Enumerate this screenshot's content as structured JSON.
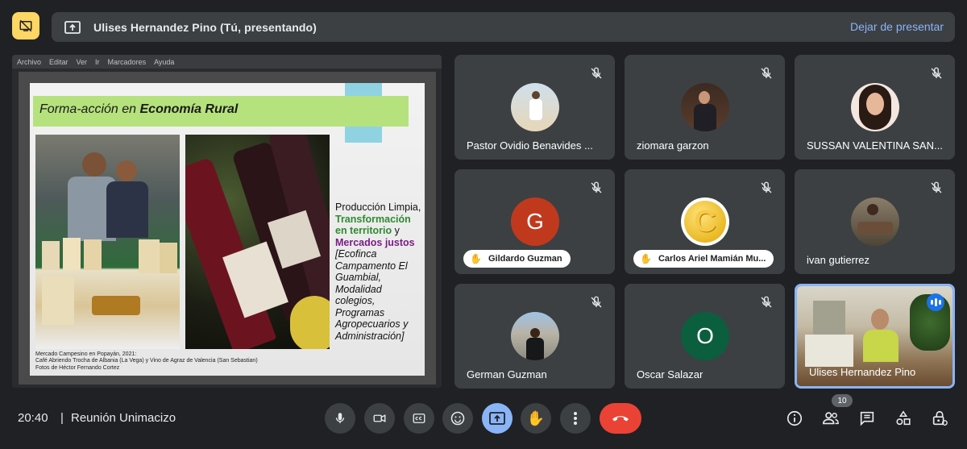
{
  "colors": {
    "accent": "#8ab4f8",
    "end_call": "#ea4335",
    "present_badge": "#fdd663",
    "background": "#202124",
    "tile": "#3c4043"
  },
  "top": {
    "presenting_icon": "no-present-icon",
    "banner_title": "Ulises Hernandez Pino (Tú, presentando)",
    "stop_label": "Dejar de presentar"
  },
  "shared_screen": {
    "menu": [
      "Archivo",
      "Editar",
      "Ver",
      "Ir",
      "Marcadores",
      "Ayuda"
    ],
    "slide": {
      "title_prefix": "Forma-acción en ",
      "title_bold": "Economía Rural",
      "text_1": "Producción Limpia, ",
      "text_green": "Transformación en territorio",
      "text_2": " y ",
      "text_purple": "Mercados justos",
      "text_italic": " [Ecofinca Campamento El Guambial, Modalidad colegios, Programas Agropecuarios y Administración]",
      "caption_1": "Mercado Campesino en Popayán, 2021:",
      "caption_2": "Café Abriendo Trocha de Albania (La Vega) y Vino de Agraz de Valencia (San Sebastian)",
      "caption_3": "Fotos de Héctor Fernando Cortez"
    }
  },
  "participants": [
    {
      "name": "Pastor Ovidio Benavides ...",
      "avatar": "photo",
      "muted": true
    },
    {
      "name": "ziomara garzon",
      "avatar": "photo",
      "muted": true
    },
    {
      "name": "SUSSAN VALENTINA SAN...",
      "avatar": "photo",
      "muted": true
    },
    {
      "name": "Gildardo Guzman",
      "avatar_letter": "G",
      "avatar_color": "#c1391d",
      "hand_raised": true,
      "muted": true
    },
    {
      "name": "Carlos Ariel Mamián Mu...",
      "avatar_letter": "C",
      "avatar_color": "#f5c518",
      "hand_raised": true,
      "muted": true
    },
    {
      "name": "ivan gutierrez",
      "avatar": "photo",
      "muted": true
    },
    {
      "name": "German Guzman",
      "avatar": "photo",
      "muted": true
    },
    {
      "name": "Oscar Salazar",
      "avatar_letter": "O",
      "avatar_color": "#0b5e3e",
      "muted": true
    },
    {
      "name": "Ulises Hernandez Pino",
      "avatar": "video",
      "speaking": true
    }
  ],
  "bottom": {
    "time": "20:40",
    "separator": "|",
    "meeting_name": "Reunión Unimacizo",
    "participant_count": "10",
    "controls": [
      "mic-icon",
      "camera-icon",
      "captions-icon",
      "emoji-icon",
      "present-screen-icon",
      "raise-hand-icon",
      "more-options-icon",
      "end-call-icon"
    ],
    "right_controls": [
      "info-icon",
      "people-icon",
      "chat-icon",
      "activities-icon",
      "host-controls-icon"
    ]
  }
}
